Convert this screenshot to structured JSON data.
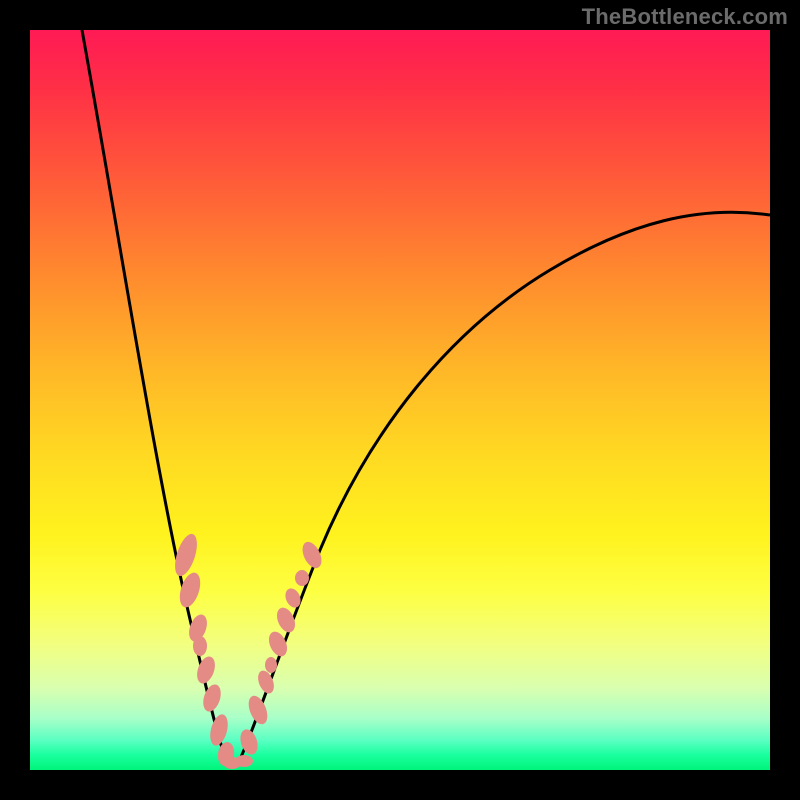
{
  "watermark": {
    "text": "TheBottleneck.com"
  },
  "chart_data": {
    "type": "line",
    "title": "",
    "xlabel": "",
    "ylabel": "",
    "xlim": [
      0,
      100
    ],
    "ylim": [
      0,
      100
    ],
    "series": [
      {
        "name": "bottleneck-curve-left",
        "x": [
          7,
          9,
          11,
          13,
          15,
          17,
          19,
          21,
          23,
          25
        ],
        "y": [
          100,
          86,
          72,
          59,
          46,
          35,
          25,
          16,
          8,
          1
        ]
      },
      {
        "name": "bottleneck-curve-right",
        "x": [
          27,
          30,
          34,
          38,
          44,
          50,
          58,
          66,
          76,
          86,
          100
        ],
        "y": [
          1,
          7,
          15,
          23,
          32,
          40,
          48,
          55,
          62,
          68,
          75
        ]
      }
    ],
    "annotations": [
      {
        "name": "marker-cluster-left",
        "approx_x_range": [
          19,
          25
        ],
        "approx_y_range": [
          3,
          30
        ],
        "color": "#e38b84"
      },
      {
        "name": "marker-cluster-right",
        "approx_x_range": [
          27,
          36
        ],
        "approx_y_range": [
          1,
          30
        ],
        "color": "#e38b84"
      }
    ],
    "background": "rainbow-gradient-red-to-green",
    "optimal_x": 26
  }
}
